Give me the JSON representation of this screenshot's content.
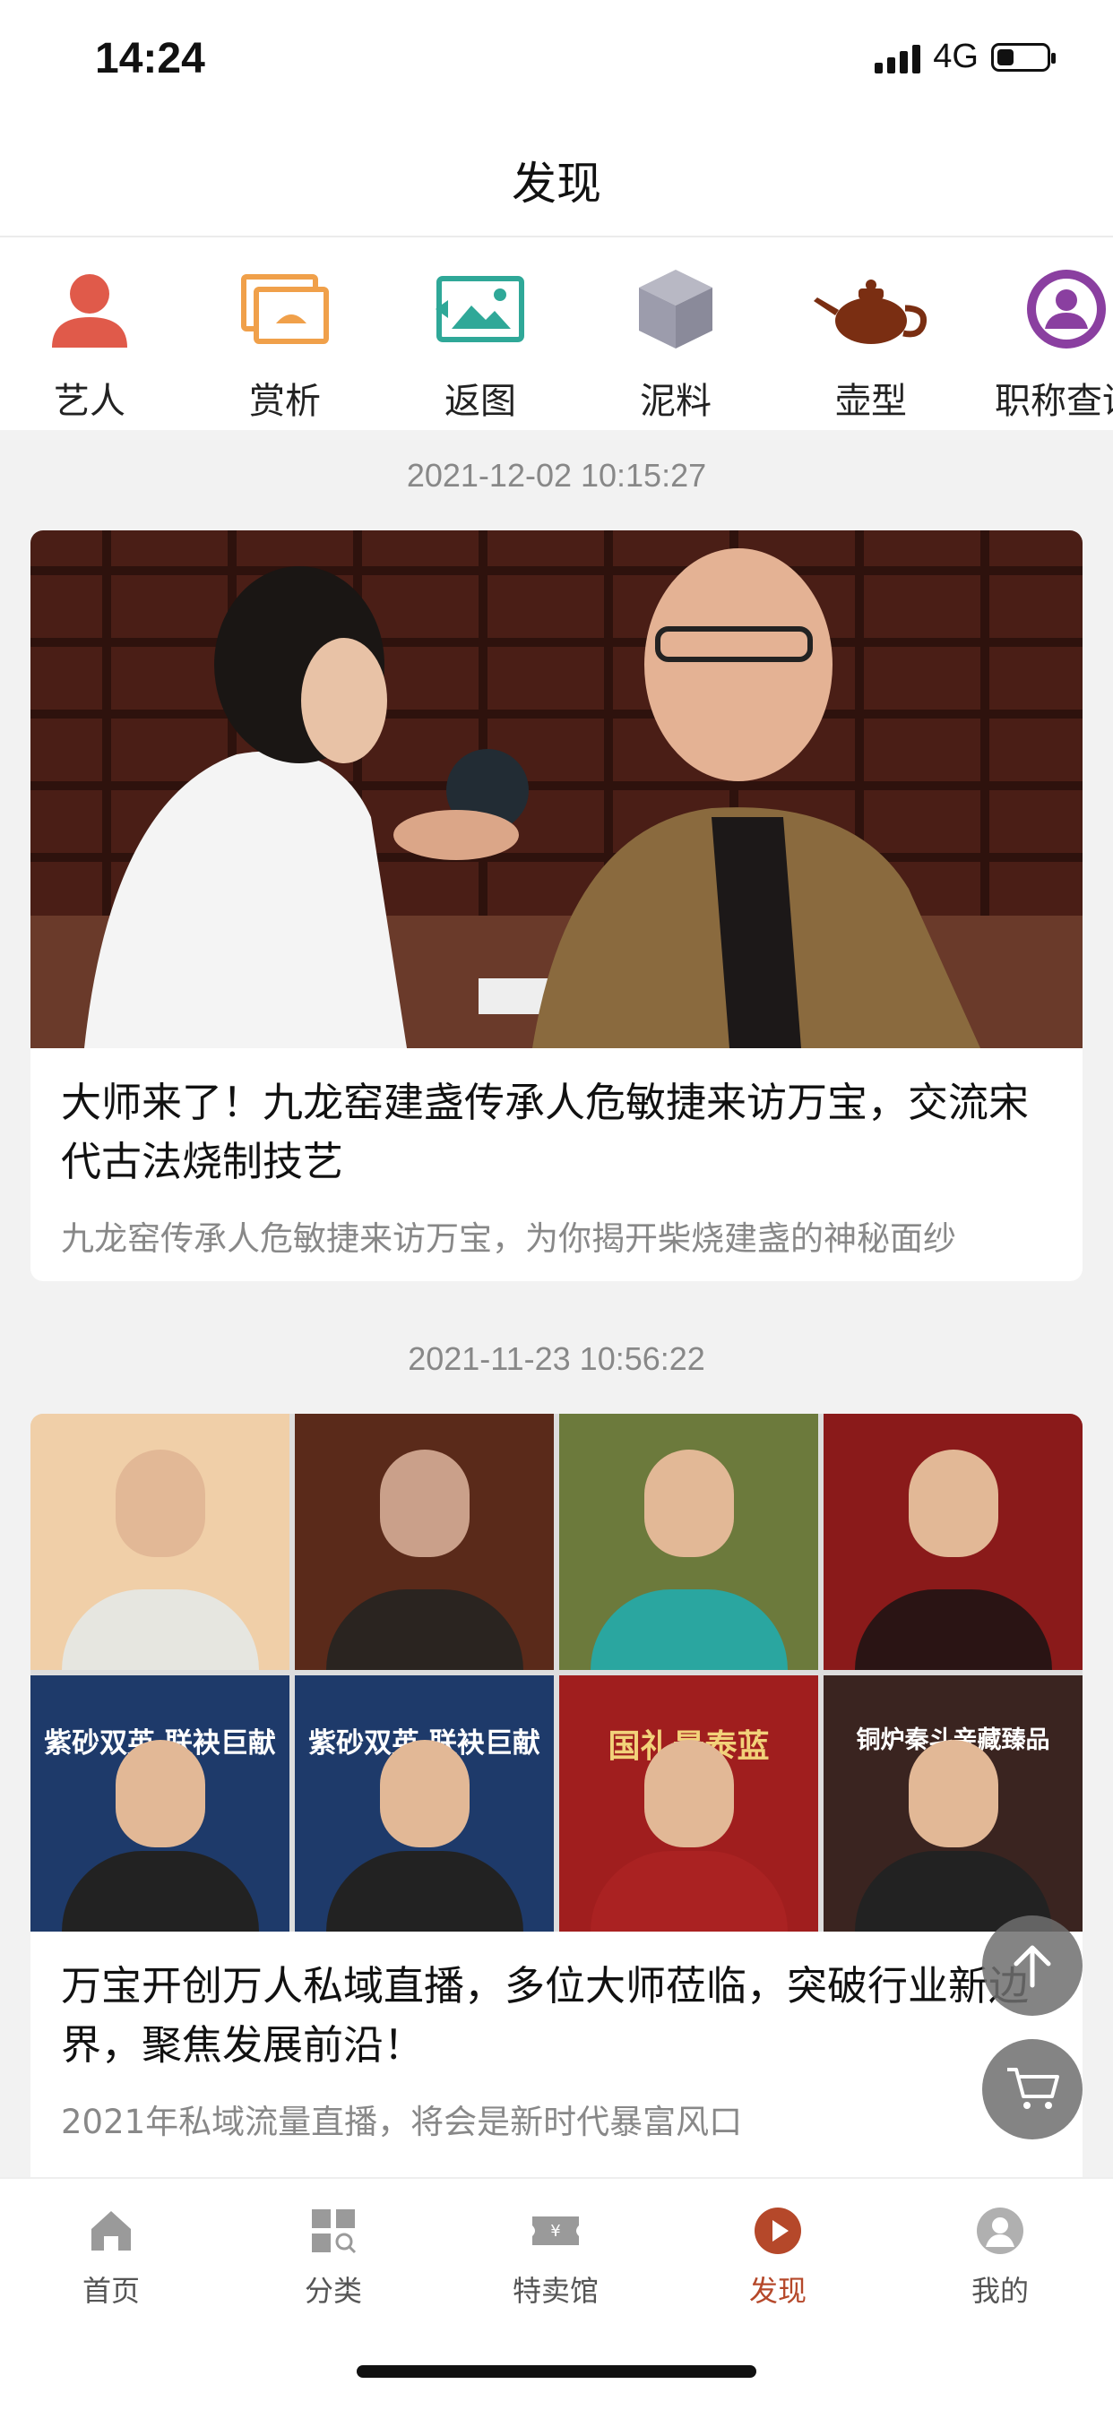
{
  "status_bar": {
    "time": "14:24",
    "network": "4G",
    "battery_level": 0.3
  },
  "header": {
    "title": "发现"
  },
  "categories": [
    {
      "label": "艺人",
      "icon": "person-icon"
    },
    {
      "label": "赏析",
      "icon": "picture-frame-icon"
    },
    {
      "label": "返图",
      "icon": "image-return-icon"
    },
    {
      "label": "泥料",
      "icon": "clay-cube-icon"
    },
    {
      "label": "壶型",
      "icon": "teapot-icon"
    },
    {
      "label": "职称查询",
      "icon": "certificate-person-icon"
    }
  ],
  "feed": [
    {
      "timestamp": "2021-12-02 10:15:27",
      "title": "大师来了！九龙窑建盏传承人危敏捷来访万宝，交流宋代古法烧制技艺",
      "summary": "九龙窑传承人危敏捷来访万宝，为你揭开柴烧建盏的神秘面纱"
    },
    {
      "timestamp": "2021-11-23 10:56:22",
      "title": "万宝开创万人私域直播，多位大师莅临，突破行业新边界，聚焦发展前沿！",
      "summary": "2021年私域流量直播，将会是新时代暴富风口",
      "poster_captions": [
        "紫砂双英 联袂巨献",
        "紫砂双英 联袂巨献",
        "国礼景泰蓝",
        "铜炉秦斗亲藏臻品"
      ]
    }
  ],
  "floating_buttons": {
    "scroll_top": "arrow-up-icon",
    "cart": "cart-icon"
  },
  "tabbar": {
    "items": [
      {
        "label": "首页",
        "icon": "home-icon"
      },
      {
        "label": "分类",
        "icon": "category-grid-icon"
      },
      {
        "label": "特卖馆",
        "icon": "ticket-icon"
      },
      {
        "label": "发现",
        "icon": "play-circle-icon"
      },
      {
        "label": "我的",
        "icon": "profile-icon"
      }
    ],
    "active_index": 3,
    "active_color": "#b5482a"
  }
}
